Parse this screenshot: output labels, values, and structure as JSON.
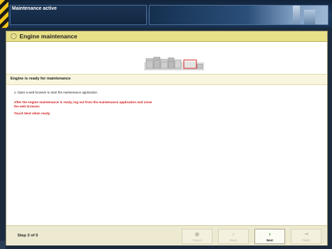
{
  "topbar": {
    "title": "Maintenance active"
  },
  "dialog": {
    "title": "Engine maintenance",
    "status": "Engine is ready for maintenance",
    "instruction": "1. Open a web browser to start the maintenance application.",
    "warning": "After the engine maintenance is ready, log out from the maintenance application and close the web browser.",
    "prompt": "Touch Next when ready.",
    "step": "Step 3 of 5",
    "buttons": {
      "cancel": "Cancel",
      "back": "Back",
      "next": "Next",
      "finish": "Finish"
    }
  },
  "colors": {
    "header": "#e8e088",
    "warning": "#d32020",
    "next_icon": "#3c9a33"
  }
}
